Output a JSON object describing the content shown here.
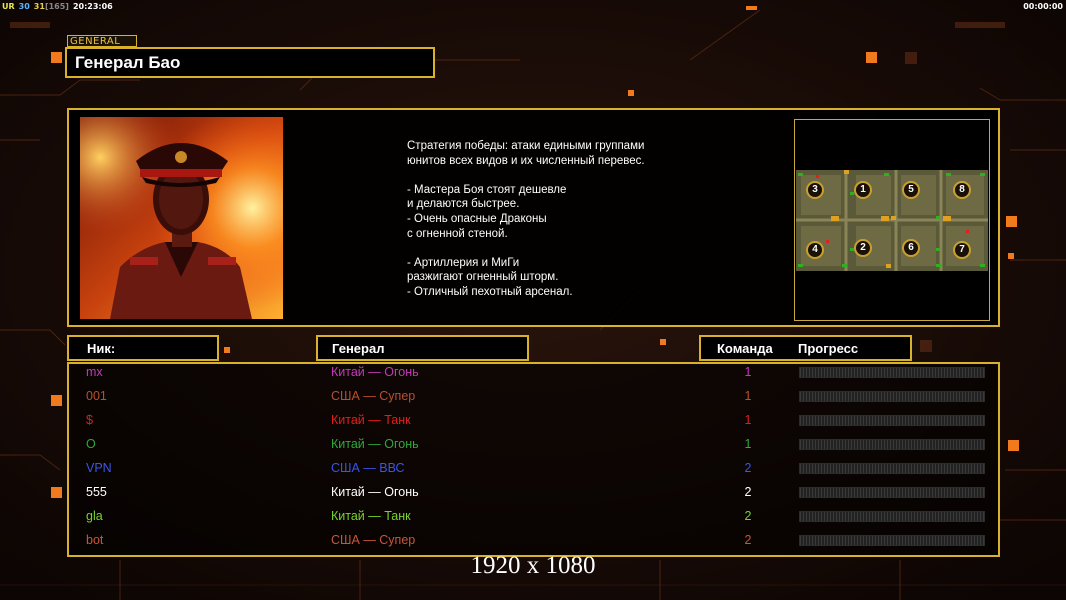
{
  "top_bar": {
    "ur_label": "UR",
    "num1": "30",
    "num2": "31",
    "num3": "[165]",
    "clock": "20:23:06",
    "timer": "00:00:00"
  },
  "colors": {
    "accent_gold": "#d8b22a",
    "orange_square": "#f07a1c"
  },
  "general": {
    "tag": "GENERAL",
    "name": "Генерал Бао",
    "description": [
      "Стратегия победы: атаки едиными группами",
      "юнитов всех видов и их численный перевес.",
      "",
      "- Мастера Боя стоят дешевле",
      "и делаются быстрее.",
      "- Очень опасные Драконы",
      "с огненной стеной.",
      "",
      "- Артиллерия и МиГи",
      "разжигают огненный шторм.",
      "- Отличный пехотный арсенал."
    ]
  },
  "map": {
    "slots": [
      "3",
      "1",
      "5",
      "8",
      "4",
      "2",
      "6",
      "7"
    ]
  },
  "table": {
    "headers": {
      "nick": "Ник:",
      "general": "Генерал",
      "team": "Команда",
      "progress": "Прогресс"
    },
    "rows": [
      {
        "nick": "mx",
        "general": "Китай — Огонь",
        "team": "1",
        "color": "#c23ab8"
      },
      {
        "nick": "001",
        "general": "США — Супер",
        "team": "1",
        "color": "#b8502e"
      },
      {
        "nick": "$",
        "general": "Китай — Танк",
        "team": "1",
        "color": "#e01e1e"
      },
      {
        "nick": "O",
        "general": "Китай — Огонь",
        "team": "1",
        "color": "#2fa83a"
      },
      {
        "nick": "VPN",
        "general": "США — ВВС",
        "team": "2",
        "color": "#3a55e8"
      },
      {
        "nick": "555",
        "general": "Китай — Огонь",
        "team": "2",
        "color": "#ffffff"
      },
      {
        "nick": "gla",
        "general": "Китай — Танк",
        "team": "2",
        "color": "#78d42a"
      },
      {
        "nick": "bot",
        "general": "США — Супер",
        "team": "2",
        "color": "#c8563a"
      }
    ]
  },
  "resolution": "1920 x 1080"
}
